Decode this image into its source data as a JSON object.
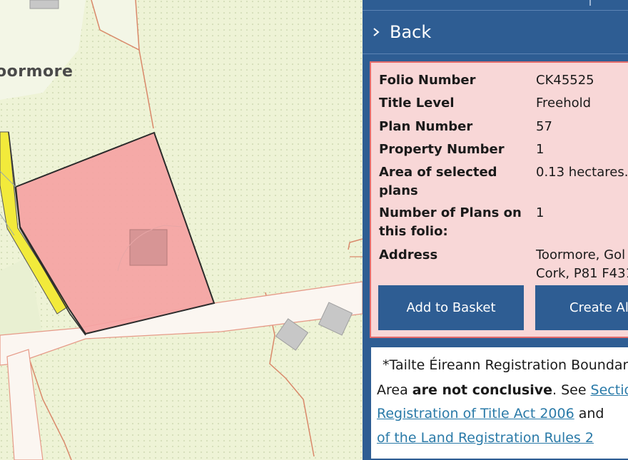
{
  "map": {
    "place_label": "oormore"
  },
  "panel": {
    "back_label": "Back",
    "details": [
      {
        "label": "Folio Number",
        "value": "CK45525"
      },
      {
        "label": "Title Level",
        "value": "Freehold"
      },
      {
        "label": "Plan Number",
        "value": "57"
      },
      {
        "label": "Property Number",
        "value": "1"
      },
      {
        "label": "Area of selected\nplans",
        "value": "0.13 hectares."
      },
      {
        "label": "Number of Plans on\nthis folio:",
        "value": "1"
      },
      {
        "label": "Address",
        "value": "Toormore, Gol\nCork, P81 F431"
      }
    ],
    "buttons": {
      "add_to_basket": "Add to Basket",
      "create_alert": "Create Al"
    },
    "notice": {
      "line1": "*Tailte Éireann Registration Boundari",
      "line2_pre": "Area ",
      "line2_bold": "are not conclusive",
      "line2_mid": ". See ",
      "line2_link": "Sectio",
      "line3_link": "Registration of Title Act 2006",
      "line3_post": " and",
      "line4_link": "of the Land Registration Rules 2"
    }
  },
  "colors": {
    "panel_bg": "#2e5d93",
    "parcel_fill": "#f5a3a3",
    "info_bg": "#f8d7d7",
    "info_border": "#e36b6b",
    "map_bg": "#eef3d6",
    "road_yellow": "#f2ea3b",
    "link": "#2a7aa8"
  },
  "icons": {
    "back": "chevron-right-icon"
  }
}
